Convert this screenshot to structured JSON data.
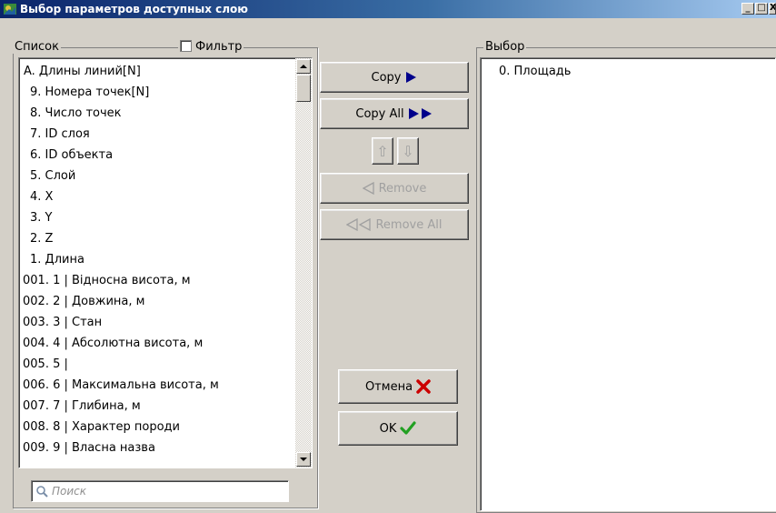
{
  "window": {
    "title": "Выбор параметров доступных слою",
    "controls": [
      "_",
      "□",
      "X"
    ]
  },
  "left_group": {
    "label": "Список",
    "filter_label": "Фильтр",
    "filter_checked": false,
    "items": [
      "A. Длины линий[N]",
      "9. Номера точек[N]",
      "8. Число точек",
      "7. ID слоя",
      "6. ID объекта",
      "5. Слой",
      "4. X",
      "3. Y",
      "2. Z",
      "1. Длина",
      "001. 1 | Відносна висота, м",
      "002. 2 | Довжина, м",
      "003. 3 | Стан",
      "004. 4 | Абсолютна висота, м",
      "005. 5 |",
      "006. 6 | Максимальна висота, м",
      "007. 7 | Глибина, м",
      "008. 8 | Характер породи",
      "009. 9 | Власна назва"
    ],
    "search_placeholder": "Поиск"
  },
  "buttons": {
    "copy": "Copy",
    "copy_all": "Copy All",
    "up": "⇧",
    "down": "⇩",
    "remove": "Remove",
    "remove_all": "Remove All",
    "cancel": "Отмена",
    "ok": "OK"
  },
  "right_group": {
    "label": "Выбор",
    "items": [
      "0. Площадь"
    ]
  },
  "colors": {
    "arrow": "#00008b",
    "cancel_x": "#cc0000",
    "ok_check": "#22a022"
  }
}
